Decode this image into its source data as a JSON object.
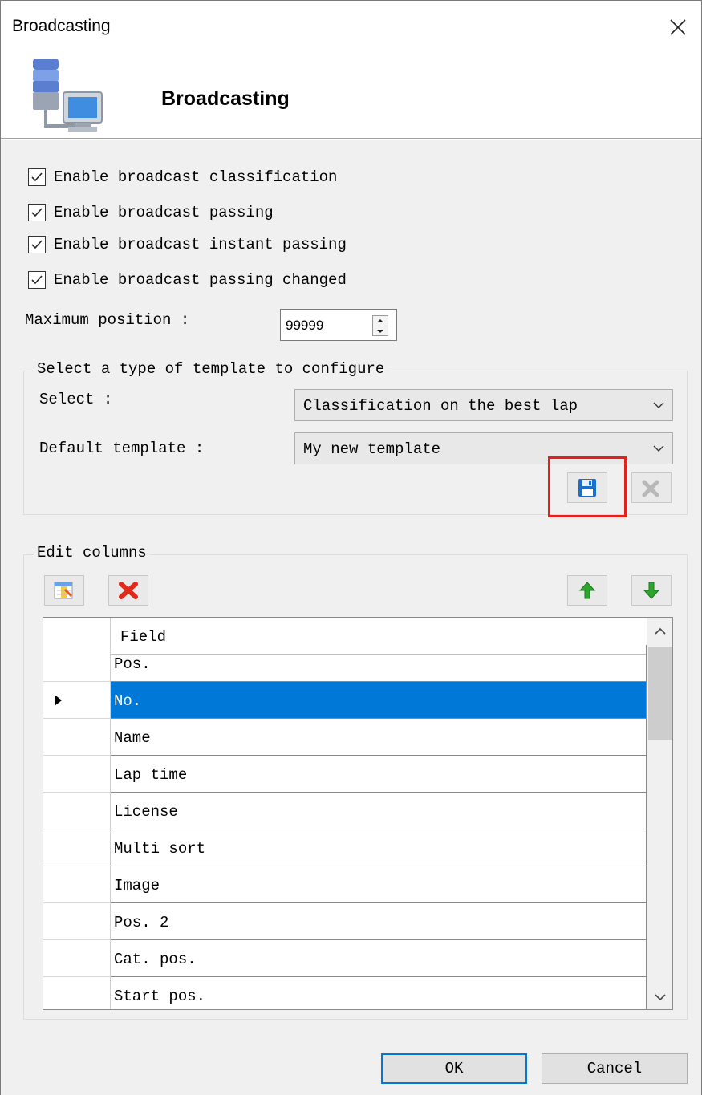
{
  "window": {
    "title": "Broadcasting"
  },
  "header": {
    "title": "Broadcasting",
    "icon": "database-computer-icon"
  },
  "options": [
    {
      "label": "Enable broadcast classification",
      "checked": true
    },
    {
      "label": "Enable broadcast passing",
      "checked": true
    },
    {
      "label": "Enable broadcast instant passing",
      "checked": true
    },
    {
      "label": "Enable broadcast passing changed",
      "checked": true
    }
  ],
  "max_position": {
    "label": "Maximum position :",
    "value": "99999"
  },
  "template_group": {
    "legend": "Select a type of template to configure",
    "select_label": "Select :",
    "select_value": "Classification on the best lap",
    "default_label": "Default template :",
    "default_value": "My new template"
  },
  "columns_group": {
    "legend": "Edit columns",
    "header": "Field",
    "selected_row": 1,
    "rows": [
      "Pos.",
      "No.",
      "Name",
      "Lap time",
      "License",
      "Multi sort",
      "Image",
      "Pos. 2",
      "Cat. pos.",
      "Start pos."
    ]
  },
  "buttons": {
    "ok": "OK",
    "cancel": "Cancel"
  },
  "colors": {
    "selection": "#0078d7",
    "highlight_box": "#e3201b",
    "save_icon": "#1b6fc8",
    "delete_icon": "#e02a1a",
    "arrow_icon": "#2fa52f"
  }
}
